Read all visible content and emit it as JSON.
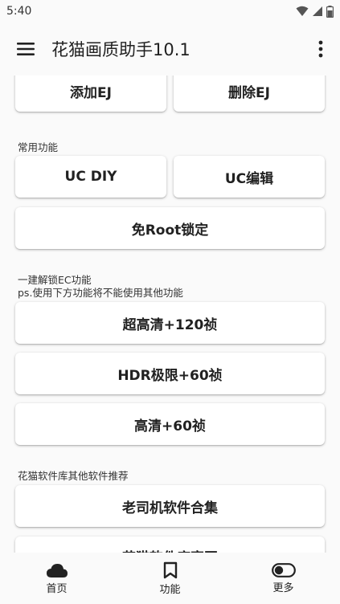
{
  "status": {
    "time": "5:40"
  },
  "appbar": {
    "title": "花猫画质助手10.1",
    "menu_icon": "menu-icon",
    "more_icon": "more-vert-icon"
  },
  "top_row": {
    "add_label": "添加EJ",
    "delete_label": "删除EJ"
  },
  "common": {
    "section_label": "常用功能",
    "uc_diy_label": "UC DIY",
    "uc_edit_label": "UC编辑",
    "no_root_label": "免Root锁定"
  },
  "unlock": {
    "section_label_1": "一建解锁EC功能",
    "section_label_2": "ps.使用下方功能将不能使用其他功能",
    "ultra_label": "超高清+120祯",
    "hdr_label": "HDR极限+60祯",
    "hd_label": "高清+60祯"
  },
  "recommend": {
    "section_label": "花猫软件库其他软件推荐",
    "driver_label": "老司机软件合集",
    "partial_label": "花猫软件库官网"
  },
  "bottom_nav": {
    "items": [
      {
        "label": "首页",
        "icon": "cloud-icon"
      },
      {
        "label": "功能",
        "icon": "bookmark-icon"
      },
      {
        "label": "更多",
        "icon": "toggle-icon"
      }
    ]
  }
}
